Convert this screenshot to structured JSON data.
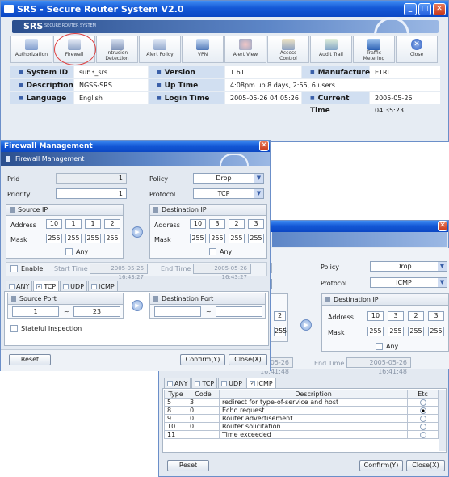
{
  "main_window": {
    "title": "SRS - Secure Router System V2.0",
    "brand": "SRS",
    "brand_sub": "SECURE ROUTER SYSTEM",
    "toolbar": [
      {
        "label": "Authorization",
        "icon": "authorization-icon"
      },
      {
        "label": "Firewall",
        "icon": "firewall-icon"
      },
      {
        "label": "Intrusion\nDetection",
        "icon": "intrusion-detection-icon"
      },
      {
        "label": "Alert Policy",
        "icon": "alert-policy-icon"
      },
      {
        "label": "VPN",
        "icon": "vpn-icon"
      },
      {
        "label": "Alert View",
        "icon": "alert-view-icon"
      },
      {
        "label": "Access\nControl",
        "icon": "access-control-icon"
      },
      {
        "label": "Audit Trail",
        "icon": "audit-trail-icon"
      },
      {
        "label": "Traffic\nMetering",
        "icon": "traffic-metering-icon"
      },
      {
        "label": "Close",
        "icon": "close-icon"
      }
    ],
    "info": {
      "system_id_label": "System ID",
      "system_id": "sub3_srs",
      "version_label": "Version",
      "version": "1.61",
      "manufacturer_label": "Manufacturer",
      "manufacturer": "ETRI",
      "description_label": "Description",
      "description": "NGSS-SRS",
      "uptime_label": "Up Time",
      "uptime": "4:08pm  up 8 days,  2:55,  6 users",
      "language_label": "Language",
      "language": "English",
      "login_label": "Login Time",
      "login": "2005-05-26 04:05:26",
      "current_label": "Current Time",
      "current": "2005-05-26 04:35:23"
    }
  },
  "fw_dialog": {
    "title": "Firewall Management",
    "subtitle": "Firewall Management",
    "prid_label": "Prid",
    "prid": "1",
    "priority_label": "Priority",
    "priority": "1",
    "policy_label": "Policy",
    "policy": "Drop",
    "protocol_label": "Protocol",
    "protocol": "TCP",
    "source_ip_label": "Source IP",
    "dest_ip_label": "Destination IP",
    "address_label": "Address",
    "mask_label": "Mask",
    "any_label": "Any",
    "src_addr": [
      "10",
      "1",
      "1",
      "2"
    ],
    "src_mask": [
      "255",
      "255",
      "255",
      "255"
    ],
    "dst_addr": [
      "10",
      "3",
      "2",
      "3"
    ],
    "dst_mask": [
      "255",
      "255",
      "255",
      "255"
    ],
    "enable_label": "Enable",
    "start_time_label": "Start Time",
    "start_time": "2005-05-26 16:43:27",
    "end_time_label": "End Time",
    "end_time": "2005-05-26 16:43:27",
    "tabs": [
      "ANY",
      "TCP",
      "UDP",
      "ICMP"
    ],
    "source_port_label": "Source Port",
    "src_port_from": "1",
    "src_port_to": "23",
    "dest_port_label": "Destination Port",
    "tilde": "~",
    "stateful_label": "Stateful Inspection",
    "reset": "Reset",
    "confirm": "Confirm(Y)",
    "close": "Close(X)"
  },
  "icmp_dialog": {
    "policy_label": "Policy",
    "policy": "Drop",
    "protocol_label": "Protocol",
    "protocol": "ICMP",
    "dest_ip_label": "Destination IP",
    "address_label": "Address",
    "mask_label": "Mask",
    "any_label": "Any",
    "src_addr_tail": "2",
    "src_mask_tail": "255",
    "dst_addr": [
      "10",
      "3",
      "2",
      "3"
    ],
    "dst_mask": [
      "255",
      "255",
      "255",
      "255"
    ],
    "start_time": "2005-05-26 16:41:48",
    "end_time_label": "End Time",
    "end_time": "2005-05-26 16:41:48",
    "tabs": [
      "ANY",
      "TCP",
      "UDP",
      "ICMP"
    ],
    "columns": [
      "Type",
      "Code",
      "Description",
      "Etc"
    ],
    "rows": [
      {
        "type": "5",
        "code": "3",
        "desc": "redirect for type-of-service and host",
        "on": false
      },
      {
        "type": "8",
        "code": "0",
        "desc": "Echo request",
        "on": true
      },
      {
        "type": "9",
        "code": "0",
        "desc": "Router advertisement",
        "on": false
      },
      {
        "type": "10",
        "code": "0",
        "desc": "Router solicitation",
        "on": false
      },
      {
        "type": "11",
        "code": "",
        "desc": "Time exceeded",
        "on": false
      }
    ],
    "reset": "Reset",
    "confirm": "Confirm(Y)",
    "close": "Close(X)"
  }
}
